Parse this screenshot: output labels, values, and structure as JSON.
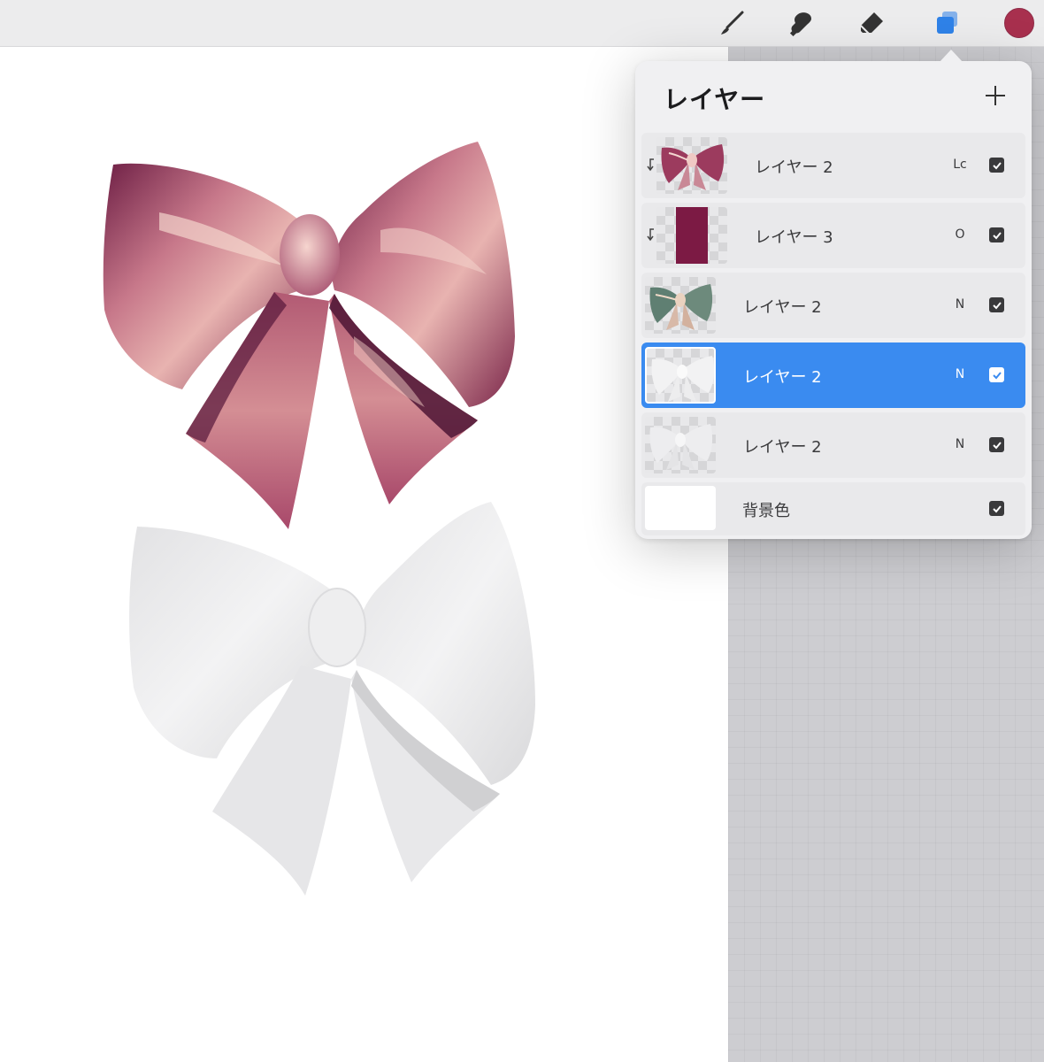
{
  "toolbar": {
    "tools": [
      {
        "icon": "brush-icon",
        "label": "brush"
      },
      {
        "icon": "smudge-icon",
        "label": "smudge"
      },
      {
        "icon": "eraser-icon",
        "label": "eraser"
      },
      {
        "icon": "layers-icon",
        "label": "layers",
        "active": true
      }
    ],
    "current_color": "#a8304e"
  },
  "colors": {
    "accent": "#3a8bf0",
    "layers_icon": "#2f82e8",
    "bow_pink": "#8a2d4f",
    "bow_gray": "#e6e6e8"
  },
  "layers_panel": {
    "title": "レイヤー",
    "add_icon": "plus-icon",
    "layers": [
      {
        "name": "レイヤー 2",
        "blend_mode": "Lc",
        "visible": true,
        "clipped": true,
        "selected": false
      },
      {
        "name": "レイヤー 3",
        "blend_mode": "O",
        "visible": true,
        "clipped": true,
        "selected": false
      },
      {
        "name": "レイヤー 2",
        "blend_mode": "N",
        "visible": true,
        "clipped": false,
        "selected": false
      },
      {
        "name": "レイヤー 2",
        "blend_mode": "N",
        "visible": true,
        "clipped": false,
        "selected": true
      },
      {
        "name": "レイヤー 2",
        "blend_mode": "N",
        "visible": true,
        "clipped": false,
        "selected": false
      }
    ],
    "background": {
      "name": "背景色",
      "visible": true
    }
  }
}
